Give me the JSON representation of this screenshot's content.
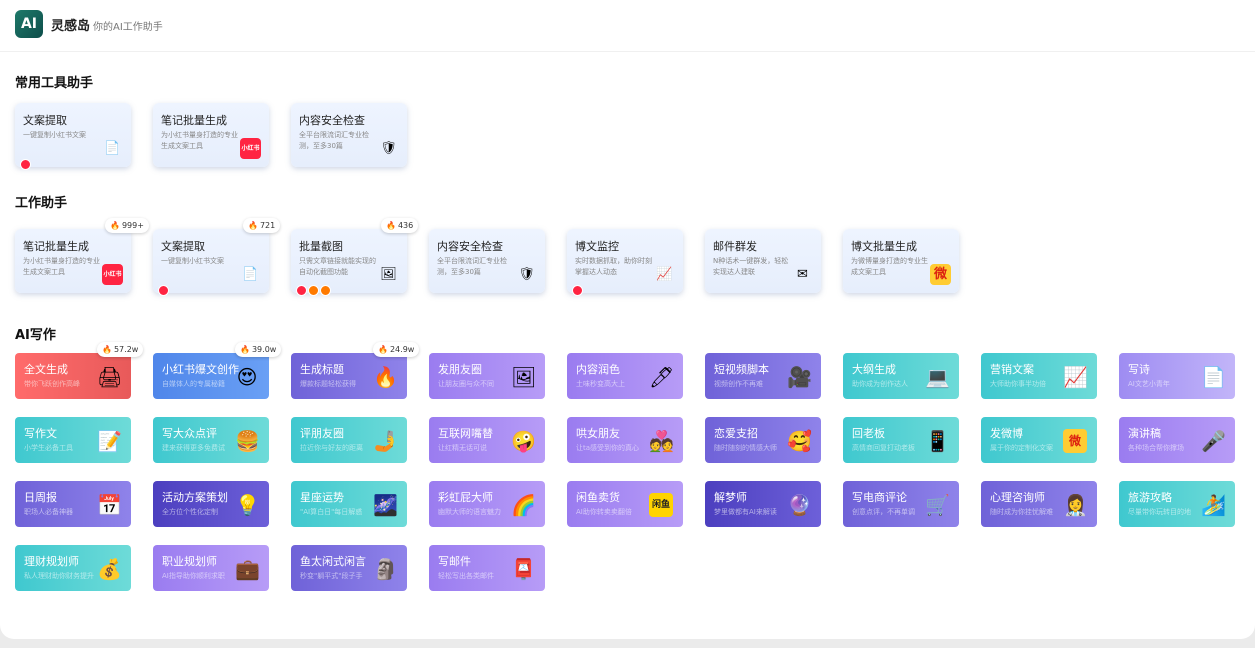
{
  "header": {
    "logo": "AI",
    "brand": "灵感岛",
    "slogan": "你的AI工作助手"
  },
  "sections": {
    "common": "常用工具助手",
    "work": "工作助手",
    "ai": "AI写作"
  },
  "common_tools": [
    {
      "title": "文案提取",
      "desc": "一键复制小红书文案",
      "icon": "document-icon",
      "glyph": "📄"
    },
    {
      "title": "笔记批量生成",
      "desc": "为小红书量身打造的专业生成文案工具",
      "icon": "xiaohongshu-icon",
      "glyph": "小红书"
    },
    {
      "title": "内容安全检查",
      "desc": "全平台限流词汇专业检测，至多30篇",
      "icon": "shield-icon",
      "glyph": "🛡"
    }
  ],
  "work_tools": [
    {
      "title": "笔记批量生成",
      "desc": "为小红书量身打造的专业生成文案工具",
      "icon": "xiaohongshu-icon",
      "glyph": "小红书",
      "hot": "999+"
    },
    {
      "title": "文案提取",
      "desc": "一键复制小红书文案",
      "icon": "document-icon",
      "glyph": "📄",
      "hot": "721"
    },
    {
      "title": "批量截图",
      "desc": "只需文章链接就能实现的自动化截图功能",
      "icon": "picture-icon",
      "glyph": "🖼",
      "hot": "436"
    },
    {
      "title": "内容安全检查",
      "desc": "全平台限流词汇专业检测，至多30篇",
      "icon": "shield-icon",
      "glyph": "🛡"
    },
    {
      "title": "博文监控",
      "desc": "实时数据抓取，助你时刻掌握达人动态",
      "icon": "chart-icon",
      "glyph": "📈"
    },
    {
      "title": "邮件群发",
      "desc": "N种话术一键群发，轻松实现达人建联",
      "icon": "mail-icon",
      "glyph": "✉"
    },
    {
      "title": "博文批量生成",
      "desc": "为微博量身打造的专业生成文案工具",
      "icon": "weibo-icon",
      "glyph": "微"
    }
  ],
  "ai_tools": [
    {
      "title": "全文生成",
      "desc": "带你飞跃创作高峰",
      "icon": "printer-icon",
      "glyph": "🖨",
      "color": "g-red",
      "hot": "57.2w"
    },
    {
      "title": "小红书爆文创作",
      "desc": "自媒体人的专属秘籍",
      "icon": "heart-eyes-icon",
      "glyph": "😍",
      "color": "g-blue",
      "hot": "39.0w"
    },
    {
      "title": "生成标题",
      "desc": "爆款标题轻松获得",
      "icon": "fire-icon",
      "glyph": "🔥",
      "color": "g-indigo",
      "hot": "24.9w"
    },
    {
      "title": "发朋友圈",
      "desc": "让朋友圈与众不同",
      "icon": "frame-icon",
      "glyph": "🖼",
      "color": "g-purple"
    },
    {
      "title": "内容润色",
      "desc": "土味秒变高大上",
      "icon": "pen-icon",
      "glyph": "🖊",
      "color": "g-purple"
    },
    {
      "title": "短视频脚本",
      "desc": "视频创作不再难",
      "icon": "camera-icon",
      "glyph": "🎥",
      "color": "g-indigo"
    },
    {
      "title": "大纲生成",
      "desc": "助你成为创作达人",
      "icon": "laptop-icon",
      "glyph": "💻",
      "color": "g-teal"
    },
    {
      "title": "营销文案",
      "desc": "大师助你事半功倍",
      "icon": "chart-icon",
      "glyph": "📈",
      "color": "g-teal"
    },
    {
      "title": "写诗",
      "desc": "AI文艺小青年",
      "icon": "document-icon",
      "glyph": "📄",
      "color": "g-lav"
    },
    {
      "title": "写作文",
      "desc": "小学生必备工具",
      "icon": "notepad-icon",
      "glyph": "📝",
      "color": "g-teal"
    },
    {
      "title": "写大众点评",
      "desc": "建来获得更多免费试",
      "icon": "burger-icon",
      "glyph": "🍔",
      "color": "g-teal"
    },
    {
      "title": "评朋友圈",
      "desc": "拉近你与好友的距离",
      "icon": "selfie-stick-icon",
      "glyph": "🤳",
      "color": "g-teal"
    },
    {
      "title": "互联网嘴替",
      "desc": "让红精无话可说",
      "icon": "crazy-face-icon",
      "glyph": "🤪",
      "color": "g-purple"
    },
    {
      "title": "哄女朋友",
      "desc": "让ta感受到你的真心",
      "icon": "couple-icon",
      "glyph": "💑",
      "color": "g-purple"
    },
    {
      "title": "恋爱支招",
      "desc": "随时随刻的情感大师",
      "icon": "smiling-hearts-icon",
      "glyph": "🥰",
      "color": "g-indigo"
    },
    {
      "title": "回老板",
      "desc": "高情商回复打动老板",
      "icon": "phone-icon",
      "glyph": "📱",
      "color": "g-teal"
    },
    {
      "title": "发微博",
      "desc": "属于你的定制化文案",
      "icon": "weibo-icon",
      "glyph": "微",
      "color": "g-teal"
    },
    {
      "title": "演讲稿",
      "desc": "各种场合帮你撑场",
      "icon": "microphone-icon",
      "glyph": "🎤",
      "color": "g-purple"
    },
    {
      "title": "日周报",
      "desc": "职场人必备神器",
      "icon": "calendar-icon",
      "glyph": "📅",
      "color": "g-indigo"
    },
    {
      "title": "活动方案策划",
      "desc": "全方位个性化定制",
      "icon": "lightbulb-icon",
      "glyph": "💡",
      "color": "g-deep"
    },
    {
      "title": "星座运势",
      "desc": "\"AI算白日\"每日解惑",
      "icon": "stars-icon",
      "glyph": "🌌",
      "color": "g-teal"
    },
    {
      "title": "彩虹屁大师",
      "desc": "幽默大师的语言魅力",
      "icon": "rainbow-icon",
      "glyph": "🌈",
      "color": "g-purple"
    },
    {
      "title": "闲鱼卖货",
      "desc": "AI助你转卖卖翻倍",
      "icon": "xianyu-icon",
      "glyph": "闲鱼",
      "color": "g-purple"
    },
    {
      "title": "解梦师",
      "desc": "梦里做都有AI来解读",
      "icon": "crystal-ball-icon",
      "glyph": "🔮",
      "color": "g-deep"
    },
    {
      "title": "写电商评论",
      "desc": "创意点评，不再单调",
      "icon": "cart-icon",
      "glyph": "🛒",
      "color": "g-indigo"
    },
    {
      "title": "心理咨询师",
      "desc": "随时成为你挂忧解难",
      "icon": "counselor-icon",
      "glyph": "👩‍⚕️",
      "color": "g-indigo"
    },
    {
      "title": "旅游攻略",
      "desc": "尽量带你玩转目的地",
      "icon": "surfer-icon",
      "glyph": "🏄",
      "color": "g-teal"
    },
    {
      "title": "理财规划师",
      "desc": "私人理财助你财务提升",
      "icon": "money-bag-icon",
      "glyph": "💰",
      "color": "g-teal"
    },
    {
      "title": "职业规划师",
      "desc": "AI指导助你顺利求职",
      "icon": "briefcase-icon",
      "glyph": "💼",
      "color": "g-purple"
    },
    {
      "title": "鱼太闲式闲言",
      "desc": "秒变\"躺平式\"段子手",
      "icon": "statue-icon",
      "glyph": "🗿",
      "color": "g-indigo"
    },
    {
      "title": "写邮件",
      "desc": "轻松写出各类邮件",
      "icon": "mailbox-icon",
      "glyph": "📮",
      "color": "g-purple"
    }
  ]
}
